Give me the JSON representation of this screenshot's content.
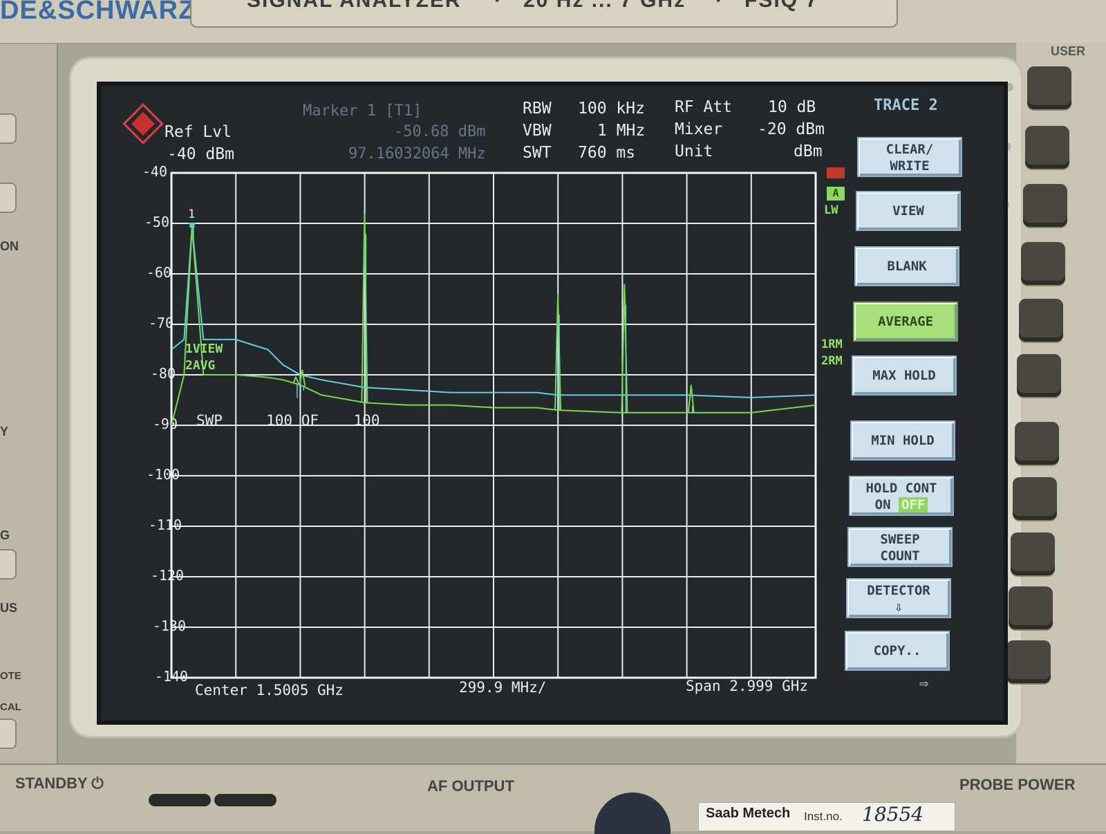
{
  "instrument": {
    "brand": "DE&SCHWARZ",
    "title_parts": [
      "SIGNAL ANALYZER",
      "·",
      "20 Hz ... 7 GHz",
      "·",
      "FSIQ 7"
    ],
    "user_label": "USER",
    "left_labels": [
      "ON",
      "Y",
      "G",
      "US",
      "OTE",
      "CAL"
    ],
    "bottom_labels": {
      "standby": "STANDBY ⏻",
      "af_output": "AF OUTPUT",
      "probe_power": "PROBE POWER"
    },
    "asset_sticker": {
      "company": "Saab Metech",
      "inst_label": "Inst.no.",
      "inst_number": "18554"
    }
  },
  "header": {
    "ref_lvl_label": "Ref Lvl",
    "ref_lvl_value": "-40 dBm",
    "marker_title": "Marker 1 [T1]",
    "marker_level": "-50.68 dBm",
    "marker_freq": "97.16032064 MHz",
    "rbw_label": "RBW",
    "rbw_value": "100 kHz",
    "vbw_label": "VBW",
    "vbw_value": "1 MHz",
    "swt_label": "SWT",
    "swt_value": "760 ms",
    "rfatt_label": "RF Att",
    "rfatt_value": "10 dB",
    "mixer_label": "Mixer",
    "mixer_value": "-20 dBm",
    "unit_label": "Unit",
    "unit_value": "dBm",
    "trace_title": "TRACE 2"
  },
  "indicators": {
    "a": "A",
    "lw": "LW",
    "trace1_mode": "1RM",
    "trace2_mode": "2RM"
  },
  "trace_labels": {
    "t1": "1VIEW",
    "t2": "2AVG",
    "sweep": "SWP     100 OF    100",
    "marker_num": "1"
  },
  "footer": {
    "center": "Center 1.5005 GHz",
    "div": "299.9 MHz/",
    "span": "Span 2.999 GHz",
    "arrow": "⇨"
  },
  "softkeys": [
    {
      "line1": "CLEAR/",
      "line2": "WRITE",
      "active": false
    },
    {
      "line1": "VIEW",
      "line2": "",
      "active": false
    },
    {
      "line1": "BLANK",
      "line2": "",
      "active": false
    },
    {
      "line1": "AVERAGE",
      "line2": "",
      "active": true
    },
    {
      "line1": "MAX HOLD",
      "line2": "",
      "active": false
    },
    {
      "line1": "MIN HOLD",
      "line2": "",
      "active": false
    },
    {
      "line1": "HOLD  CONT",
      "line2_on": "ON",
      "line2_off": "OFF",
      "active": false
    },
    {
      "line1": "SWEEP",
      "line2": "COUNT",
      "active": false
    },
    {
      "line1": "DETECTOR",
      "line2": "⇩",
      "active": false
    },
    {
      "line1": "COPY..",
      "line2": "",
      "active": false
    }
  ],
  "chart_data": {
    "type": "line",
    "xlabel": "",
    "ylabel": "",
    "xlim": [
      1,
      3000
    ],
    "ylim": [
      -140,
      -40
    ],
    "x_unit": "MHz",
    "y_unit": "dBm",
    "y_ticks": [
      -40,
      -50,
      -60,
      -70,
      -80,
      -90,
      -100,
      -110,
      -120,
      -130,
      -140
    ],
    "grid": true,
    "series": [
      {
        "name": "1VIEW",
        "color": "#5fd3dc",
        "x": [
          1,
          60,
          97,
          150,
          300,
          450,
          520,
          600,
          700,
          900,
          1100,
          1300,
          1500,
          1700,
          1800,
          2100,
          2400,
          2700,
          3000
        ],
        "y": [
          -75,
          -73,
          -50.68,
          -73,
          -73,
          -75,
          -78,
          -80,
          -81,
          -82.5,
          -83,
          -83.5,
          -83.5,
          -83.5,
          -84,
          -84,
          -84,
          -84.5,
          -84
        ]
      },
      {
        "name": "2AVG",
        "color": "#7cd64a",
        "x": [
          1,
          60,
          97,
          150,
          300,
          450,
          520,
          600,
          700,
          900,
          1100,
          1300,
          1500,
          1700,
          1800,
          2100,
          2400,
          2700,
          3000
        ],
        "y": [
          -90,
          -80,
          -50.68,
          -80,
          -80,
          -80.5,
          -81,
          -82,
          -84,
          -85.5,
          -86,
          -86,
          -86.5,
          -86.5,
          -87,
          -87.5,
          -87.5,
          -87.5,
          -86
        ]
      }
    ],
    "peaks": [
      {
        "x": 97,
        "y": -50.68
      },
      {
        "x": 580,
        "y": -80.5
      },
      {
        "x": 610,
        "y": -79
      },
      {
        "x": 900,
        "y": -48
      },
      {
        "x": 1800,
        "y": -64
      },
      {
        "x": 2110,
        "y": -62
      },
      {
        "x": 2420,
        "y": -82
      }
    ],
    "annotations": [
      "SWP 100 OF 100"
    ]
  }
}
